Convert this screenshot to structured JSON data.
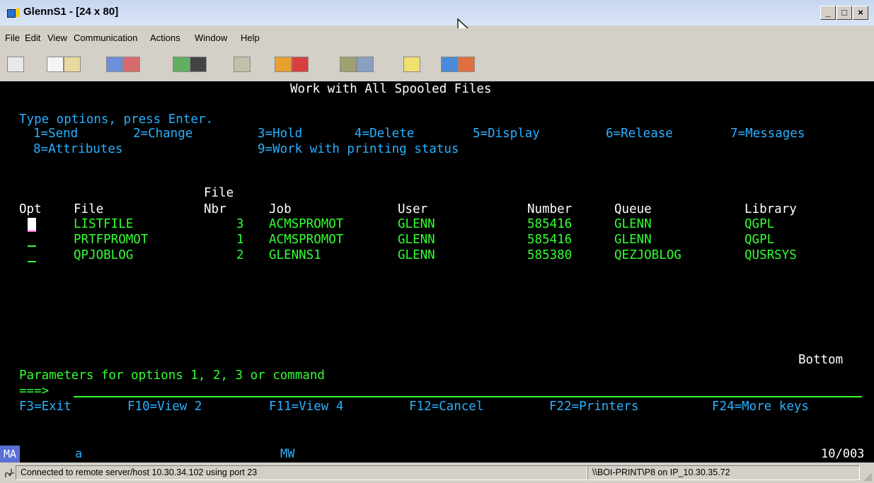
{
  "window": {
    "title": "GlennS1 - [24 x 80]",
    "minimize_label": "_",
    "maximize_label": "□",
    "close_label": "×"
  },
  "menu": {
    "items": [
      "File",
      "Edit",
      "View",
      "Communication",
      "Actions",
      "Window",
      "Help"
    ]
  },
  "terminal": {
    "screen_title": "Work with All Spooled Files",
    "instructions": "Type options, press Enter.",
    "options_row1": [
      "1=Send",
      "2=Change",
      "3=Hold",
      "4=Delete",
      "5=Display",
      "6=Release",
      "7=Messages"
    ],
    "options_row2": [
      "8=Attributes",
      "9=Work with printing status"
    ],
    "columns": {
      "file_nbr_top": "File",
      "opt": "Opt",
      "file": "File",
      "nbr": "Nbr",
      "job": "Job",
      "user": "User",
      "number": "Number",
      "queue": "Queue",
      "library": "Library"
    },
    "rows": [
      {
        "file": "LISTFILE",
        "nbr": "3",
        "job": "ACMSPROMOT",
        "user": "GLENN",
        "number": "585416",
        "queue": "GLENN",
        "library": "QGPL"
      },
      {
        "file": "PRTFPROMOT",
        "nbr": "1",
        "job": "ACMSPROMOT",
        "user": "GLENN",
        "number": "585416",
        "queue": "GLENN",
        "library": "QGPL"
      },
      {
        "file": "QPJOBLOG",
        "nbr": "2",
        "job": "GLENNS1",
        "user": "GLENN",
        "number": "585380",
        "queue": "QEZJOBLOG",
        "library": "QUSRSYS"
      }
    ],
    "bottom": "Bottom",
    "parameters_prompt": "Parameters for options 1, 2, 3 or command",
    "command_arrow": "===>",
    "fkeys": [
      "F3=Exit",
      "F10=View 2",
      "F11=View 4",
      "F12=Cancel",
      "F22=Printers",
      "F24=More keys"
    ]
  },
  "oia": {
    "ma": "MA",
    "a": "a",
    "mw": "MW",
    "cursor_pos": "10/003"
  },
  "status": {
    "connection": "Connected to remote server/host 10.30.34.102 using port 23",
    "printer": "\\\\BOI-PRINT\\P8 on IP_10.30.35.72"
  },
  "colors": {
    "green": "#33ff33",
    "white": "#ffffff",
    "blue": "#28b0ff",
    "terminal_bg": "#000000"
  }
}
